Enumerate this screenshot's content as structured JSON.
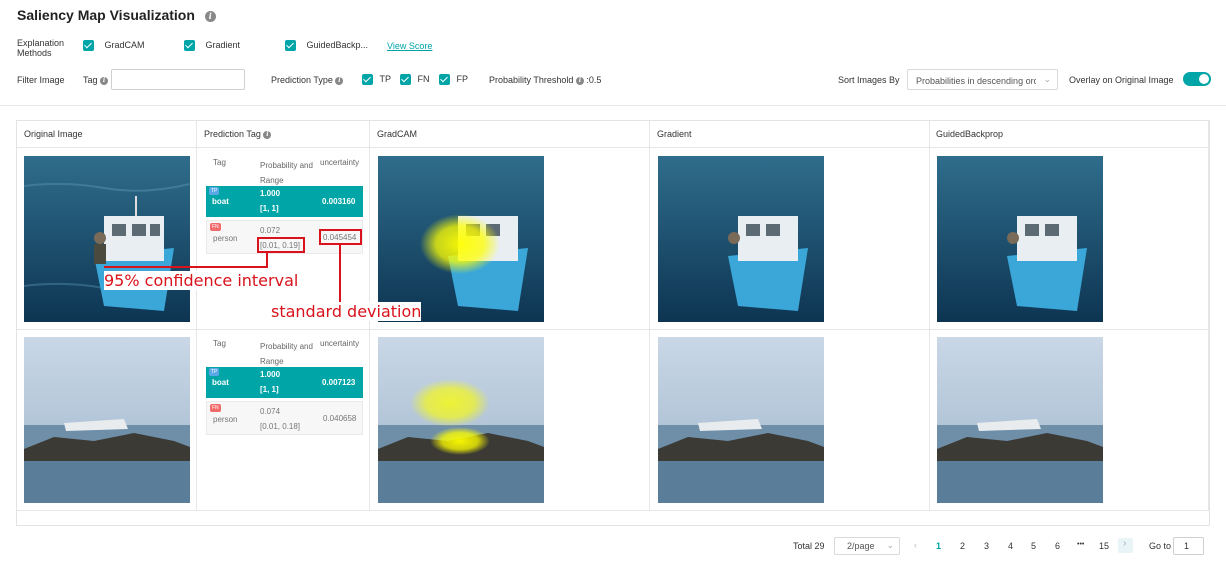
{
  "header": {
    "title": "Saliency Map Visualization"
  },
  "methods": {
    "label_line1": "Explanation",
    "label_line2": "Methods",
    "items": [
      {
        "label": "GradCAM",
        "checked": true
      },
      {
        "label": "Gradient",
        "checked": true
      },
      {
        "label": "GuidedBackp...",
        "checked": true
      }
    ],
    "view_score": "View Score"
  },
  "filter": {
    "label": "Filter Image",
    "tag_label": "Tag",
    "tag_value": "",
    "prediction_type_label": "Prediction Type",
    "types": [
      {
        "label": "TP",
        "checked": true
      },
      {
        "label": "FN",
        "checked": true
      },
      {
        "label": "FP",
        "checked": true
      }
    ],
    "threshold_label": "Probability Threshold",
    "threshold_value": ":0.5",
    "sort_label": "Sort Images By",
    "sort_value": "Probabilities in descending order",
    "overlay_label": "Overlay on Original Image",
    "overlay_on": true
  },
  "table": {
    "headers": [
      "Original Image",
      "Prediction Tag",
      "GradCAM",
      "Gradient",
      "GuidedBackprop"
    ],
    "tag_headers": {
      "tag": "Tag",
      "prob": "Probability and",
      "range": "Range",
      "uncertainty": "uncertainty"
    },
    "rows": [
      {
        "image": "boat",
        "tags": [
          {
            "type": "TP",
            "name": "boat",
            "prob": "1.000",
            "range": "[1, 1]",
            "uncertainty": "0.003160"
          },
          {
            "type": "FN",
            "name": "person",
            "prob": "0.072",
            "range": "[0.01, 0.19]",
            "uncertainty": "0.045454"
          }
        ]
      },
      {
        "image": "ship",
        "tags": [
          {
            "type": "TP",
            "name": "boat",
            "prob": "1.000",
            "range": "[1, 1]",
            "uncertainty": "0.007123"
          },
          {
            "type": "FN",
            "name": "person",
            "prob": "0.074",
            "range": "[0.01, 0.18]",
            "uncertainty": "0.040658"
          }
        ]
      }
    ]
  },
  "annotations": {
    "ci": "95% confidence interval",
    "sd": "standard deviation"
  },
  "pagination": {
    "total": "Total 29",
    "page_size": "2/page",
    "pages": [
      "1",
      "2",
      "3",
      "4",
      "5",
      "6",
      "•••",
      "15"
    ],
    "active_page": "1",
    "goto_label": "Go to",
    "goto_value": "1"
  },
  "colors": {
    "accent": "#00a5a7",
    "annotation": "#d9121b",
    "fn_badge": "#f26b6b",
    "tp_badge": "#5aa9e6"
  }
}
